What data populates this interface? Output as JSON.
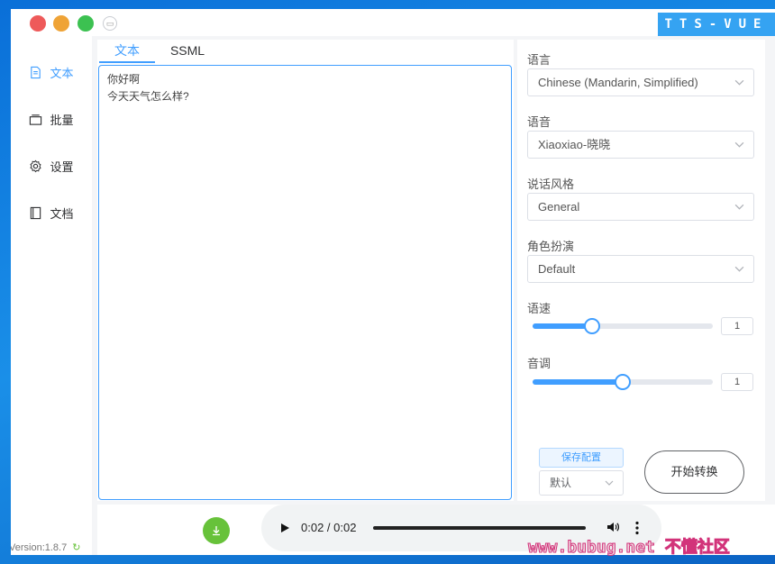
{
  "window": {
    "brand": "TTS-VUE",
    "version": "Version:1.8.7"
  },
  "sidebar": {
    "items": [
      {
        "label": "文本",
        "icon": "document-icon",
        "active": true
      },
      {
        "label": "批量",
        "icon": "folder-icon",
        "active": false
      },
      {
        "label": "设置",
        "icon": "gear-icon",
        "active": false
      },
      {
        "label": "文档",
        "icon": "book-icon",
        "active": false
      }
    ]
  },
  "editor": {
    "tabs": [
      {
        "label": "文本",
        "active": true
      },
      {
        "label": "SSML",
        "active": false
      }
    ],
    "content": "你好啊\n今天天气怎么样?"
  },
  "options": {
    "language_label": "语言",
    "language_value": "Chinese (Mandarin, Simplified)",
    "voice_label": "语音",
    "voice_value": "Xiaoxiao-晓晓",
    "style_label": "说话风格",
    "style_value": "General",
    "role_label": "角色扮演",
    "role_value": "Default",
    "speed_label": "语速",
    "speed_value": "1",
    "speed_fraction": 0.33,
    "pitch_label": "音调",
    "pitch_value": "1",
    "pitch_fraction": 0.5,
    "save_label": "保存配置",
    "preset_value": "默认",
    "convert_label": "开始转换"
  },
  "player": {
    "time": "0:02 / 0:02",
    "progress": 1.0
  },
  "watermark": "www.bubug.net 不懂社区",
  "colors": {
    "accent": "#409eff",
    "download": "#67c23a",
    "brand_bg": "#35a3f2"
  }
}
